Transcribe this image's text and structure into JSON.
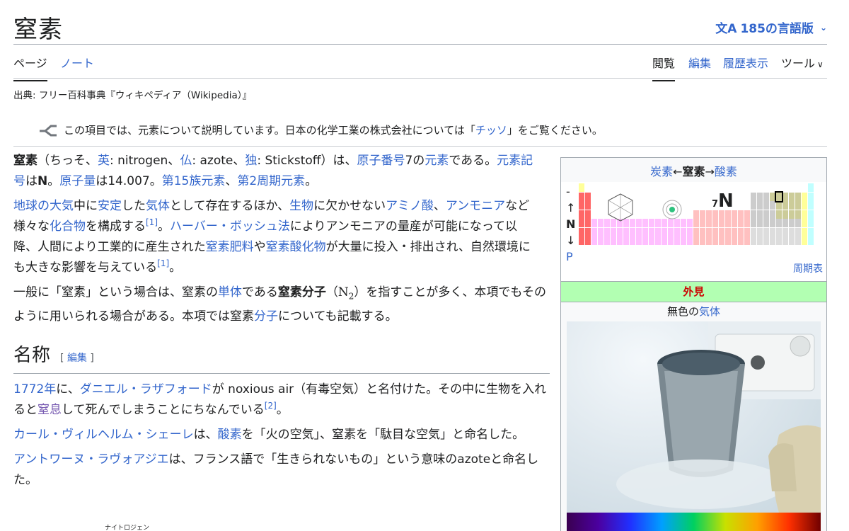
{
  "header": {
    "title": "窒素",
    "lang_icon": "文A",
    "lang_label": "185の言語版"
  },
  "tabs": {
    "left": [
      "ページ",
      "ノート"
    ],
    "right": [
      "閲覧",
      "編集",
      "履歴表示",
      "ツール"
    ]
  },
  "source": "出典: フリー百科事典『ウィキペディア（Wikipedia）』",
  "hatnote": {
    "before": "この項目では、元素について説明しています。日本の化学工業の株式会社については「",
    "link": "チッソ",
    "after": "」をご覧ください。"
  },
  "intro": {
    "p1": {
      "term": "窒素",
      "a": "（ちっそ、",
      "l1": "英",
      "b": ": nitrogen、",
      "l2": "仏",
      "c": ": azote、",
      "l3": "独",
      "d": ": Stickstoff）は、",
      "l4": "原子番号",
      "e": "7の",
      "l5": "元素",
      "f": "である。",
      "l6": "元素記号",
      "g": "は",
      "sym": "N",
      "h": "。",
      "l7": "原子量",
      "i": "は14.007。",
      "l8": "第15族元素",
      "j": "、",
      "l9": "第2周期元素",
      "k": "。"
    },
    "p2": {
      "l1": "地球の大気",
      "a": "中に",
      "l2": "安定",
      "b": "した",
      "l3": "気体",
      "c": "として存在するほか、",
      "l4": "生物",
      "d": "に欠かせない",
      "l5": "アミノ酸",
      "e": "、",
      "l6": "アンモニア",
      "f": "など様々な",
      "l7": "化合物",
      "g": "を構成する",
      "ref1": "[1]",
      "h": "。",
      "l8": "ハーバー・ボッシュ法",
      "i": "によりアンモニアの量産が可能になって以降、人間により工業的に産生された",
      "l9": "窒素肥料",
      "j": "や",
      "l10": "窒素酸化物",
      "k": "が大量に投入・排出され、自然環境にも大きな影響を与えている",
      "ref2": "[1]",
      "l": "。"
    },
    "p3": {
      "a": "一般に「窒素」という場合は、窒素の",
      "l1": "単体",
      "b": "である",
      "term": "窒素分子",
      "formula_open": "（N",
      "formula_sub": "2",
      "formula_close": "）",
      "c": "を指すことが多く、本項でもそのように用いられる場合がある。本項では窒素",
      "l2": "分子",
      "d": "についても記載する。"
    }
  },
  "section_name": {
    "heading": "名称",
    "edit_open": "[ ",
    "edit": "編集",
    "edit_close": " ]",
    "p1": {
      "l1": "1772年",
      "a": "に、",
      "l2": "ダニエル・ラザフォード",
      "b": "が noxious air（有毒空気）と名付けた。その中に生物を入れると",
      "l3": "窒息",
      "c": "して死んでしまうことにちなんでいる",
      "ref": "[2]",
      "d": "。"
    },
    "p2": {
      "l1": "カール・ヴィルヘルム・シェーレ",
      "a": "は、",
      "l2": "酸素",
      "b": "を「火の空気」、窒素を「駄目な空気」と命名した。"
    },
    "p3": {
      "l1": "アントワーヌ・ラヴォアジエ",
      "a": "は、フランス語で「生きられないもの」という意味のazoteと命名した。"
    },
    "ruby": "ナイトロジェン"
  },
  "infobox": {
    "prev": "炭素",
    "arrow1": "←",
    "current": "窒素",
    "arrow2": "→",
    "next": "酸素",
    "side_dash": "-",
    "side_up": "↑",
    "side_sym": "N",
    "side_down": "↓",
    "side_p": "P",
    "number": "7",
    "symbol": "N",
    "periodic_table_link": "周期表",
    "appearance_header": "外見",
    "caption_before": "無色の",
    "caption_link": "気体"
  }
}
